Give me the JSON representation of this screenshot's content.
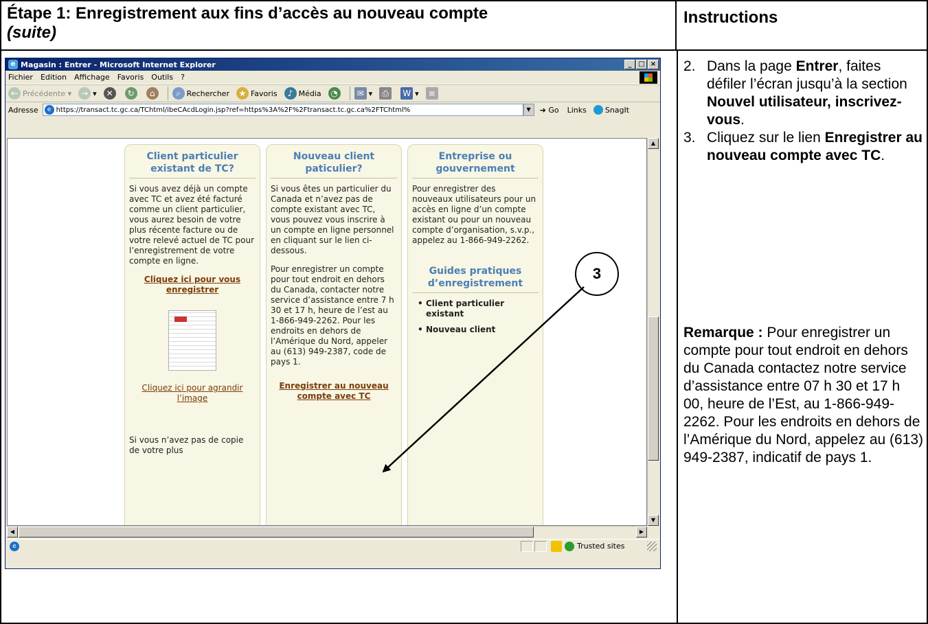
{
  "header": {
    "title_line1": "Étape 1: Enregistrement aux fins d’accès au nouveau compte",
    "title_line2": "(suite)",
    "instructions_title": "Instructions"
  },
  "instructions": {
    "step2": {
      "num": "2.",
      "pre": "Dans la page ",
      "bold1": "Entrer",
      "mid": ", faites défiler l’écran jusqu’à la section ",
      "bold2": "Nouvel utilisateur, inscrivez-vous",
      "post": "."
    },
    "step3": {
      "num": "3.",
      "pre": "Cliquez sur le lien ",
      "bold": "Enregistrer au nouveau compte avec TC",
      "post": "."
    },
    "note_label": "Remarque :",
    "note_text": " Pour enregistrer un compte pour tout endroit en dehors du Canada  contactez notre service d’assistance entre 07 h 30 et 17 h 00, heure de l’Est, au 1-866-949-2262. Pour les endroits en dehors de l’Amérique du Nord, appelez au (613) 949-2387, indicatif de pays 1."
  },
  "browser": {
    "title": "Magasin : Entrer - Microsoft Internet Explorer",
    "menu": [
      "Fichier",
      "Edition",
      "Affichage",
      "Favoris",
      "Outils",
      "?"
    ],
    "toolbar": {
      "back": "Précédente",
      "search": "Rechercher",
      "favorites": "Favoris",
      "media": "Média"
    },
    "address_label": "Adresse",
    "url": "https://transact.tc.gc.ca/TChtml/ibeCAcdLogin.jsp?ref=https%3A%2F%2Ftransact.tc.gc.ca%2FTChtml%",
    "go": "Go",
    "links": "Links",
    "snagit": "SnagIt",
    "status_zone": "Trusted sites"
  },
  "page": {
    "col1": {
      "title": "Client particulier existant de TC?",
      "text": "Si vous avez déjà un compte avec TC et avez été facturé comme un client particulier, vous aurez besoin de votre plus récente facture ou de votre relevé actuel de TC pour l’enregistrement de votre compte en ligne.",
      "link": "Cliquez ici pour vous enregistrer",
      "image_link": "Cliquez ici pour agrandir l’image",
      "footer": "Si vous n’avez pas de copie de votre plus"
    },
    "col2": {
      "title": "Nouveau client paticulier?",
      "text1": "Si vous êtes un particulier du Canada et n’avez pas de compte existant avec TC, vous pouvez vous inscrire à un compte en ligne personnel en cliquant sur le lien ci-dessous.",
      "text2": "Pour enregistrer un compte pour tout endroit en dehors du Canada, contacter notre service d’assistance entre 7 h 30 et 17 h, heure de l’est au 1-866-949-2262. Pour les endroits en dehors de l’Amérique du Nord, appeler au (613) 949-2387, code de pays 1.",
      "link": "Enregistrer au nouveau compte avec TC"
    },
    "col3": {
      "title": "Entreprise ou gouvernement",
      "text": "Pour enregistrer des nouveaux utilisateurs pour un accès en ligne d’un compte existant ou pour un nouveau compte d’organisation, s.v.p., appelez au 1-866-949-2262.",
      "guides_title": "Guides pratiques d’enregistrement",
      "guides": [
        "Client particulier existant",
        "Nouveau client"
      ]
    }
  },
  "callout": "3"
}
